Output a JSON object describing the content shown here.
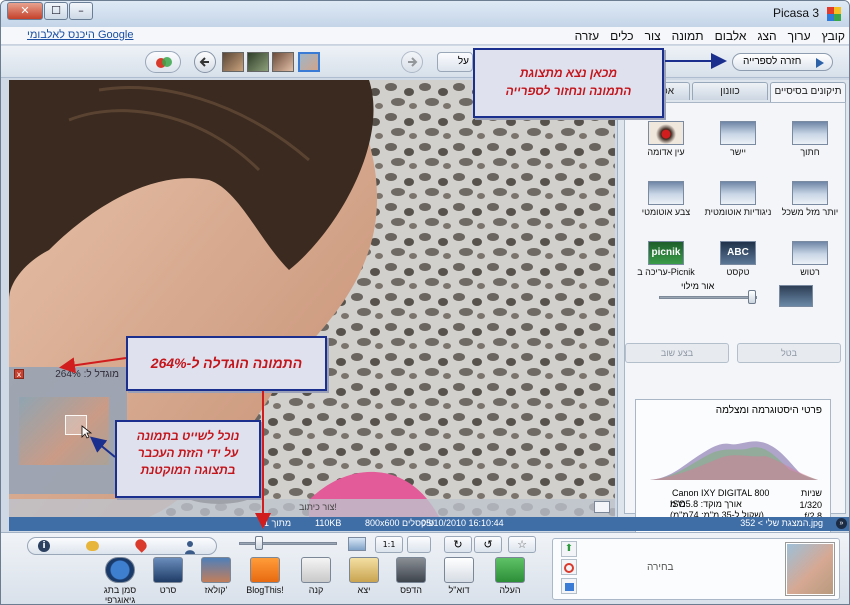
{
  "window": {
    "title": "Picasa 3",
    "close_glyph": "✕",
    "max_glyph": "☐",
    "min_glyph": "–"
  },
  "menu": [
    "קובץ",
    "ערוך",
    "הצג",
    "אלבום",
    "תמונה",
    "צור",
    "כלים",
    "עזרה"
  ],
  "google_link": "היכנס לאלבומי Google",
  "toolbar": {
    "back_to_library": "חזרה לספרייה",
    "blank_input": "על"
  },
  "viewer": {
    "zoom_label": "מוגדל ל: 264%",
    "caption_prompt": "צור כיתוב!",
    "close_glyph": "x"
  },
  "tabs": [
    "תיקונים בסיסיים",
    "כוונון",
    "אפקטים"
  ],
  "tools": [
    {
      "label": "חתוך",
      "icon": "crop-icon"
    },
    {
      "label": "יישר",
      "icon": "straighten-icon"
    },
    {
      "label": "עין אדומה",
      "icon": "red-eye-icon"
    },
    {
      "label": "יותר מזל משכל",
      "icon": "feeling-lucky-icon"
    },
    {
      "label": "ניגודיות אוטומטית",
      "icon": "auto-contrast-icon"
    },
    {
      "label": "צבע אוטומטי",
      "icon": "auto-color-icon"
    },
    {
      "label": "רטוש",
      "icon": "retouch-icon"
    },
    {
      "label": "טקסט",
      "icon": "text-icon",
      "badge": "ABC"
    },
    {
      "label": "עריכה ב-Picnik",
      "icon": "picnik-icon",
      "badge": "picnik"
    }
  ],
  "fill_light": {
    "label": "אור מילוי",
    "level": 0.95
  },
  "undo_buttons": {
    "cancel": "בטל",
    "redo": "בצע שוב"
  },
  "histogram": {
    "title": "פרטי היסטוגרמה ומצלמה",
    "shutter_label": "שניות",
    "shutter": "1/320",
    "aperture": "f/2.8",
    "camera": "Canon IXY DIGITAL 800",
    "focal_length": "אורך מוקד: 5.8מ\"מ",
    "iso": "ISO",
    "equivalent": "(שקול ל-35 מ\"מ: 74מ\"מ)"
  },
  "status": {
    "left": "המצגת שלי > 352.jpg",
    "date": "05/10/2010 16:10:44",
    "dims": "800x600 פיקסלים",
    "size": "110KB",
    "count": "(1 מתוך"
  },
  "zoom_slider": {
    "level": 0.1
  },
  "bottom_actions": [
    {
      "label": "העלה",
      "icon": "upload-icon"
    },
    {
      "label": "דוא\"ל",
      "icon": "email-icon"
    },
    {
      "label": "הדפס",
      "icon": "print-icon"
    },
    {
      "label": "יצא",
      "icon": "export-folder-icon"
    },
    {
      "label": "קנה",
      "icon": "shop-icon"
    },
    {
      "label": "BlogThis!",
      "icon": "blogger-icon"
    },
    {
      "label": "קולאז'",
      "icon": "collage-icon"
    },
    {
      "label": "סרט",
      "icon": "movie-icon"
    },
    {
      "label": "סמן בתג גיאוגרפי",
      "icon": "geotag-icon"
    }
  ],
  "selection_panel": {
    "label": "בחירה"
  },
  "annotations": {
    "top": "מכאן נצא מתצוגת\nהתמונה ונחזור לספרייה",
    "zoom": "התמונה הוגדלה ל-264%",
    "nav": "נוכל לשייט בתמונה\nעל ידי הזזת העכבר\nבתצוגה המוקטנת"
  },
  "colors": {
    "accent": "#3f6ea7",
    "callout_text": "#c4151b",
    "callout_border": "#1b2f8e"
  }
}
